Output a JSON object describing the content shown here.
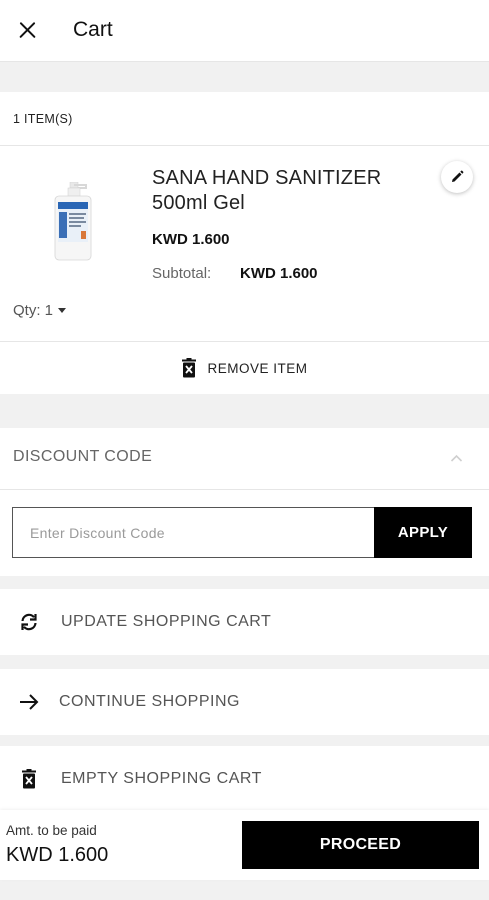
{
  "header": {
    "title": "Cart",
    "close_icon": "close-icon"
  },
  "cart": {
    "items_count_label": "1 ITEM(S)"
  },
  "product": {
    "name": "SANA HAND SANITIZER 500ml Gel",
    "price": "KWD 1.600",
    "subtotal_label": "Subtotal:",
    "subtotal_value": "KWD 1.600",
    "qty_label": "Qty: 1",
    "image_icon": "hand-sanitizer-bottle-image",
    "edit_icon": "pencil-icon",
    "remove_label": "REMOVE ITEM",
    "remove_icon": "trash-icon"
  },
  "discount": {
    "title": "DISCOUNT CODE",
    "placeholder": "Enter Discount Code",
    "value": "",
    "apply_label": "APPLY",
    "chevron_icon": "chevron-up-icon"
  },
  "actions": [
    {
      "label": "UPDATE SHOPPING CART",
      "icon": "refresh-icon"
    },
    {
      "label": "CONTINUE SHOPPING",
      "icon": "arrow-right-icon"
    },
    {
      "label": "EMPTY SHOPPING CART",
      "icon": "trash-icon"
    }
  ],
  "footer": {
    "amount_label": "Amt. to be paid",
    "amount_value": "KWD 1.600",
    "proceed_label": "PROCEED"
  },
  "colors": {
    "primary": "#000000",
    "background": "#f1f1f1",
    "surface": "#ffffff",
    "muted_text": "#666666"
  }
}
